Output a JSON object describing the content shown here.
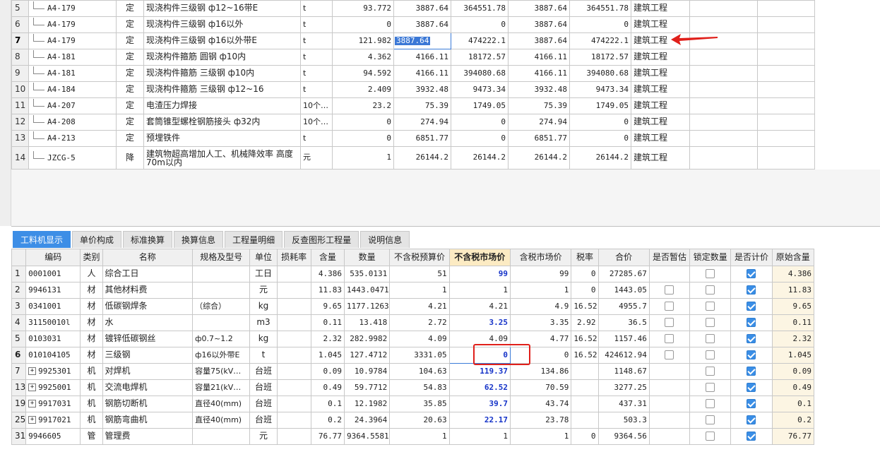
{
  "top_grid": {
    "rows": [
      {
        "no": "5",
        "code": "A4-179",
        "type": "定",
        "name": "现浇构件三级钢 ф12~16带E",
        "unit": "t",
        "qty": "93.772",
        "c1": "3887.64",
        "c2": "364551.78",
        "c3": "3887.64",
        "c4": "364551.78",
        "prof": "建筑工程"
      },
      {
        "no": "6",
        "code": "A4-179",
        "type": "定",
        "name": "现浇构件三级钢 ф16以外",
        "unit": "t",
        "qty": "0",
        "c1": "3887.64",
        "c2": "0",
        "c3": "3887.64",
        "c4": "0",
        "prof": "建筑工程"
      },
      {
        "no": "7",
        "code": "A4-179",
        "type": "定",
        "name": "现浇构件三级钢 ф16以外带E",
        "unit": "t",
        "qty": "121.982",
        "c1": "3887.64",
        "c2": "474222.1",
        "c3": "3887.64",
        "c4": "474222.1",
        "prof": "建筑工程"
      },
      {
        "no": "8",
        "code": "A4-181",
        "type": "定",
        "name": "现浇构件箍筋 圆钢 ф10内",
        "unit": "t",
        "qty": "4.362",
        "c1": "4166.11",
        "c2": "18172.57",
        "c3": "4166.11",
        "c4": "18172.57",
        "prof": "建筑工程"
      },
      {
        "no": "9",
        "code": "A4-181",
        "type": "定",
        "name": "现浇构件箍筋 三级钢 ф10内",
        "unit": "t",
        "qty": "94.592",
        "c1": "4166.11",
        "c2": "394080.68",
        "c3": "4166.11",
        "c4": "394080.68",
        "prof": "建筑工程"
      },
      {
        "no": "10",
        "code": "A4-184",
        "type": "定",
        "name": "现浇构件箍筋 三级钢 ф12~16",
        "unit": "t",
        "qty": "2.409",
        "c1": "3932.48",
        "c2": "9473.34",
        "c3": "3932.48",
        "c4": "9473.34",
        "prof": "建筑工程"
      },
      {
        "no": "11",
        "code": "A4-207",
        "type": "定",
        "name": "电渣压力焊接",
        "unit": "10个…",
        "qty": "23.2",
        "c1": "75.39",
        "c2": "1749.05",
        "c3": "75.39",
        "c4": "1749.05",
        "prof": "建筑工程"
      },
      {
        "no": "12",
        "code": "A4-208",
        "type": "定",
        "name": "套筒锥型螺栓钢筋接头 ф32内",
        "unit": "10个…",
        "qty": "0",
        "c1": "274.94",
        "c2": "0",
        "c3": "274.94",
        "c4": "0",
        "prof": "建筑工程"
      },
      {
        "no": "13",
        "code": "A4-213",
        "type": "定",
        "name": "预埋铁件",
        "unit": "t",
        "qty": "0",
        "c1": "6851.77",
        "c2": "0",
        "c3": "6851.77",
        "c4": "0",
        "prof": "建筑工程"
      },
      {
        "no": "14",
        "code": "JZCG-5",
        "type": "降",
        "name": "建筑物超高增加人工、机械降效率 高度70m以内",
        "unit": "元",
        "qty": "1",
        "c1": "26144.2",
        "c2": "26144.2",
        "c3": "26144.2",
        "c4": "26144.2",
        "prof": "建筑工程"
      }
    ]
  },
  "tabs": [
    "工料机显示",
    "单价构成",
    "标准换算",
    "换算信息",
    "工程量明细",
    "反查图形工程量",
    "说明信息"
  ],
  "bottom_grid": {
    "headers": [
      "编码",
      "类别",
      "名称",
      "规格及型号",
      "单位",
      "损耗率",
      "含量",
      "数量",
      "不含税预算价",
      "不含税市场价",
      "含税市场价",
      "税率",
      "合价",
      "是否暂估",
      "锁定数量",
      "是否计价",
      "原始含量"
    ],
    "rows": [
      {
        "no": "1",
        "expand": false,
        "code": "0001001",
        "cat": "人",
        "name": "综合工日",
        "spec": "",
        "unit": "工日",
        "loss": "",
        "content": "4.386",
        "qty": "535.0131",
        "budget": "51",
        "market": "99",
        "market_blue": true,
        "tax_market": "99",
        "tax": "0",
        "total": "27285.67",
        "est": null,
        "lock": false,
        "priced": true,
        "orig": "4.386"
      },
      {
        "no": "2",
        "expand": false,
        "code": "9946131",
        "cat": "材",
        "name": "其他材料费",
        "spec": "",
        "unit": "元",
        "loss": "",
        "content": "11.83",
        "qty": "1443.0471",
        "budget": "1",
        "market": "1",
        "market_blue": false,
        "tax_market": "1",
        "tax": "0",
        "total": "1443.05",
        "est": false,
        "lock": false,
        "priced": true,
        "orig": "11.83"
      },
      {
        "no": "3",
        "expand": false,
        "code": "0341001",
        "cat": "材",
        "name": "低碳钢焊条",
        "spec": "（综合）",
        "unit": "kg",
        "loss": "",
        "content": "9.65",
        "qty": "1177.1263",
        "budget": "4.21",
        "market": "4.21",
        "market_blue": false,
        "tax_market": "4.9",
        "tax": "16.52",
        "total": "4955.7",
        "est": false,
        "lock": false,
        "priced": true,
        "orig": "9.65"
      },
      {
        "no": "4",
        "expand": false,
        "code": "31150010l",
        "cat": "材",
        "name": "水",
        "spec": "",
        "unit": "m3",
        "loss": "",
        "content": "0.11",
        "qty": "13.418",
        "budget": "2.72",
        "market": "3.25",
        "market_blue": true,
        "tax_market": "3.35",
        "tax": "2.92",
        "total": "36.5",
        "est": false,
        "lock": false,
        "priced": true,
        "orig": "0.11"
      },
      {
        "no": "5",
        "expand": false,
        "code": "0103031",
        "cat": "材",
        "name": "镀锌低碳钢丝",
        "spec": "ф0.7~1.2",
        "unit": "kg",
        "loss": "",
        "content": "2.32",
        "qty": "282.9982",
        "budget": "4.09",
        "market": "4.09",
        "market_blue": false,
        "tax_market": "4.77",
        "tax": "16.52",
        "total": "1157.46",
        "est": false,
        "lock": false,
        "priced": true,
        "orig": "2.32"
      },
      {
        "no": "6",
        "expand": false,
        "code": "010104105",
        "cat": "材",
        "name": "三级钢",
        "spec": "ф16以外带E",
        "unit": "t",
        "loss": "",
        "content": "1.045",
        "qty": "127.4712",
        "budget": "3331.05",
        "market": "0",
        "market_blue": true,
        "tax_market": "0",
        "tax": "16.52",
        "total": "424612.94",
        "est": false,
        "lock": false,
        "priced": true,
        "orig": "1.045"
      },
      {
        "no": "7",
        "expand": true,
        "code": "9925301",
        "cat": "机",
        "name": "对焊机",
        "spec": "容量75(kV…",
        "unit": "台班",
        "loss": "",
        "content": "0.09",
        "qty": "10.9784",
        "budget": "104.63",
        "market": "119.37",
        "market_blue": true,
        "tax_market": "134.86",
        "tax": "",
        "total": "1148.67",
        "est": null,
        "lock": false,
        "priced": true,
        "orig": "0.09"
      },
      {
        "no": "13",
        "expand": true,
        "code": "9925001",
        "cat": "机",
        "name": "交流电焊机",
        "spec": "容量21(kV…",
        "unit": "台班",
        "loss": "",
        "content": "0.49",
        "qty": "59.7712",
        "budget": "54.83",
        "market": "62.52",
        "market_blue": true,
        "tax_market": "70.59",
        "tax": "",
        "total": "3277.25",
        "est": null,
        "lock": false,
        "priced": true,
        "orig": "0.49"
      },
      {
        "no": "19",
        "expand": true,
        "code": "9917031",
        "cat": "机",
        "name": "钢筋切断机",
        "spec": "直径40(mm)",
        "unit": "台班",
        "loss": "",
        "content": "0.1",
        "qty": "12.1982",
        "budget": "35.85",
        "market": "39.7",
        "market_blue": true,
        "tax_market": "43.74",
        "tax": "",
        "total": "437.31",
        "est": null,
        "lock": false,
        "priced": true,
        "orig": "0.1"
      },
      {
        "no": "25",
        "expand": true,
        "code": "9917021",
        "cat": "机",
        "name": "钢筋弯曲机",
        "spec": "直径40(mm)",
        "unit": "台班",
        "loss": "",
        "content": "0.2",
        "qty": "24.3964",
        "budget": "20.63",
        "market": "22.17",
        "market_blue": true,
        "tax_market": "23.78",
        "tax": "",
        "total": "503.3",
        "est": null,
        "lock": false,
        "priced": true,
        "orig": "0.2"
      },
      {
        "no": "31",
        "expand": false,
        "code": "9946605",
        "cat": "管",
        "name": "管理费",
        "spec": "",
        "unit": "元",
        "loss": "",
        "content": "76.77",
        "qty": "9364.5581",
        "budget": "1",
        "market": "1",
        "market_blue": false,
        "tax_market": "1",
        "tax": "0",
        "total": "9364.56",
        "est": null,
        "lock": false,
        "priced": true,
        "orig": "76.77"
      }
    ]
  },
  "colors": {
    "tab_active": "#3d8ee6",
    "highlight_header": "#fcebc3",
    "blue_value": "#1533c8",
    "annotation_red": "#e0201b",
    "selection": "#3b78d6"
  }
}
